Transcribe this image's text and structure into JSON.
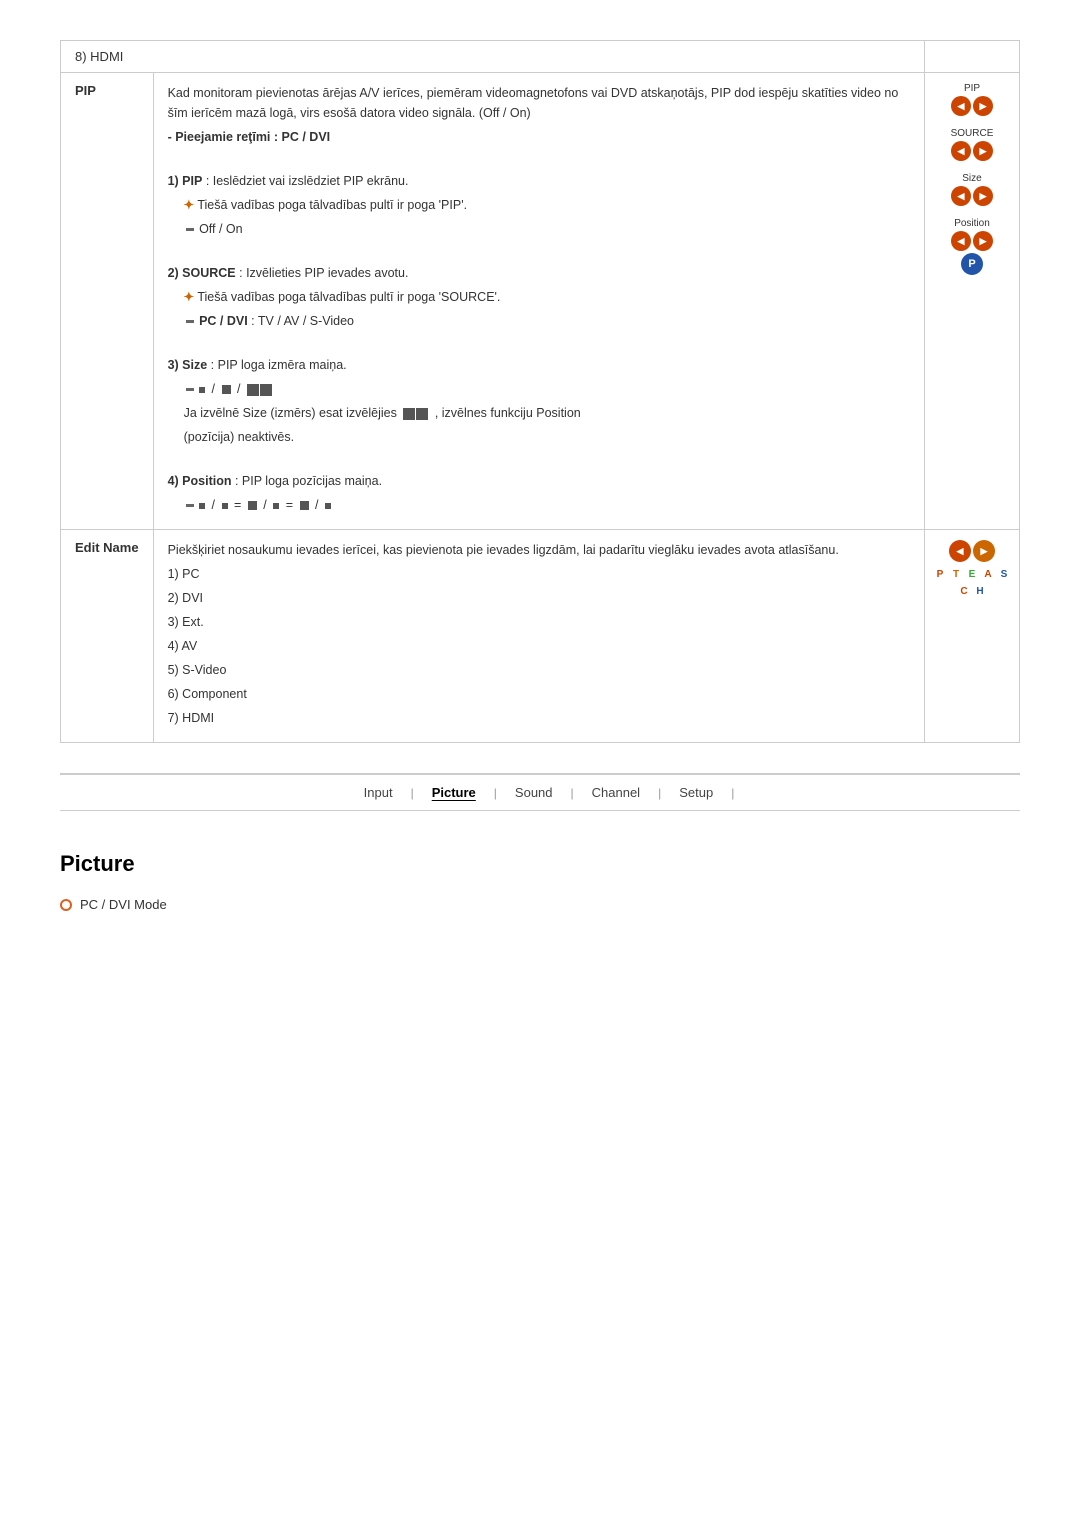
{
  "hdmi_row": {
    "label": "8) HDMI"
  },
  "pip": {
    "label": "PIP",
    "description": "Kad monitoram pievienotas ārējas A/V ierīces, piemēram videomagnetofons vai DVD atskaņotājs, PIP dod iespēju skatīties video no šīm ierīcēm mazā logā, virs esošā datora video signāla. (Off / On)",
    "modes": "- Pieejamie reţīmi : PC / DVI",
    "item1_title": "1) PIP",
    "item1_desc": ": Ieslēdziet vai izslēdziet PIP ekrānu.",
    "item1_sub": "Tiešā vadības poga tālvadības pultī ir poga 'PIP'.",
    "item1_sub2": "Off / On",
    "item2_title": "2) SOURCE",
    "item2_desc": ": Izvēlieties PIP ievades avotu.",
    "item2_sub": "Tiešā vadības poga tālvadības pultī ir poga 'SOURCE'.",
    "item2_sub2": "PC / DVI",
    "item2_sub3": ": TV / AV / S-Video",
    "item3_title": "3) Size",
    "item3_desc": ": PIP loga izmēra maiņa.",
    "item3_sub": "Ja izvēlnē Size (izmērs) esat izvēlējies",
    "item3_sub2": ", izvēlnes funkciju Position",
    "item3_sub3": "(pozīcija) neaktivēs.",
    "item4_title": "4) Position",
    "item4_desc": ": PIP loga pozīcijas maiņa.",
    "pip_icon_label": "PIP",
    "source_icon_label": "SOURCE",
    "size_icon_label": "Size",
    "position_icon_label": "Position"
  },
  "edit_name": {
    "label": "Edit Name",
    "description": "Piekšķiriet nosaukumu ievades ierīcei, kas pievienota pie ievades ligzdām, lai padarītu vieglāku ievades avota atlasīšanu.",
    "item1": "1) PC",
    "item2": "2) DVI",
    "item3": "3) Ext.",
    "item4": "4) AV",
    "item5": "5) S-Video",
    "item6": "6) Component",
    "item7": "7) HDMI"
  },
  "nav": {
    "items": [
      {
        "label": "Input",
        "active": false
      },
      {
        "label": "Picture",
        "active": true
      },
      {
        "label": "Sound",
        "active": false
      },
      {
        "label": "Channel",
        "active": false
      },
      {
        "label": "Setup",
        "active": false
      }
    ]
  },
  "picture_section": {
    "title": "Picture",
    "item1": "PC / DVI Mode"
  }
}
